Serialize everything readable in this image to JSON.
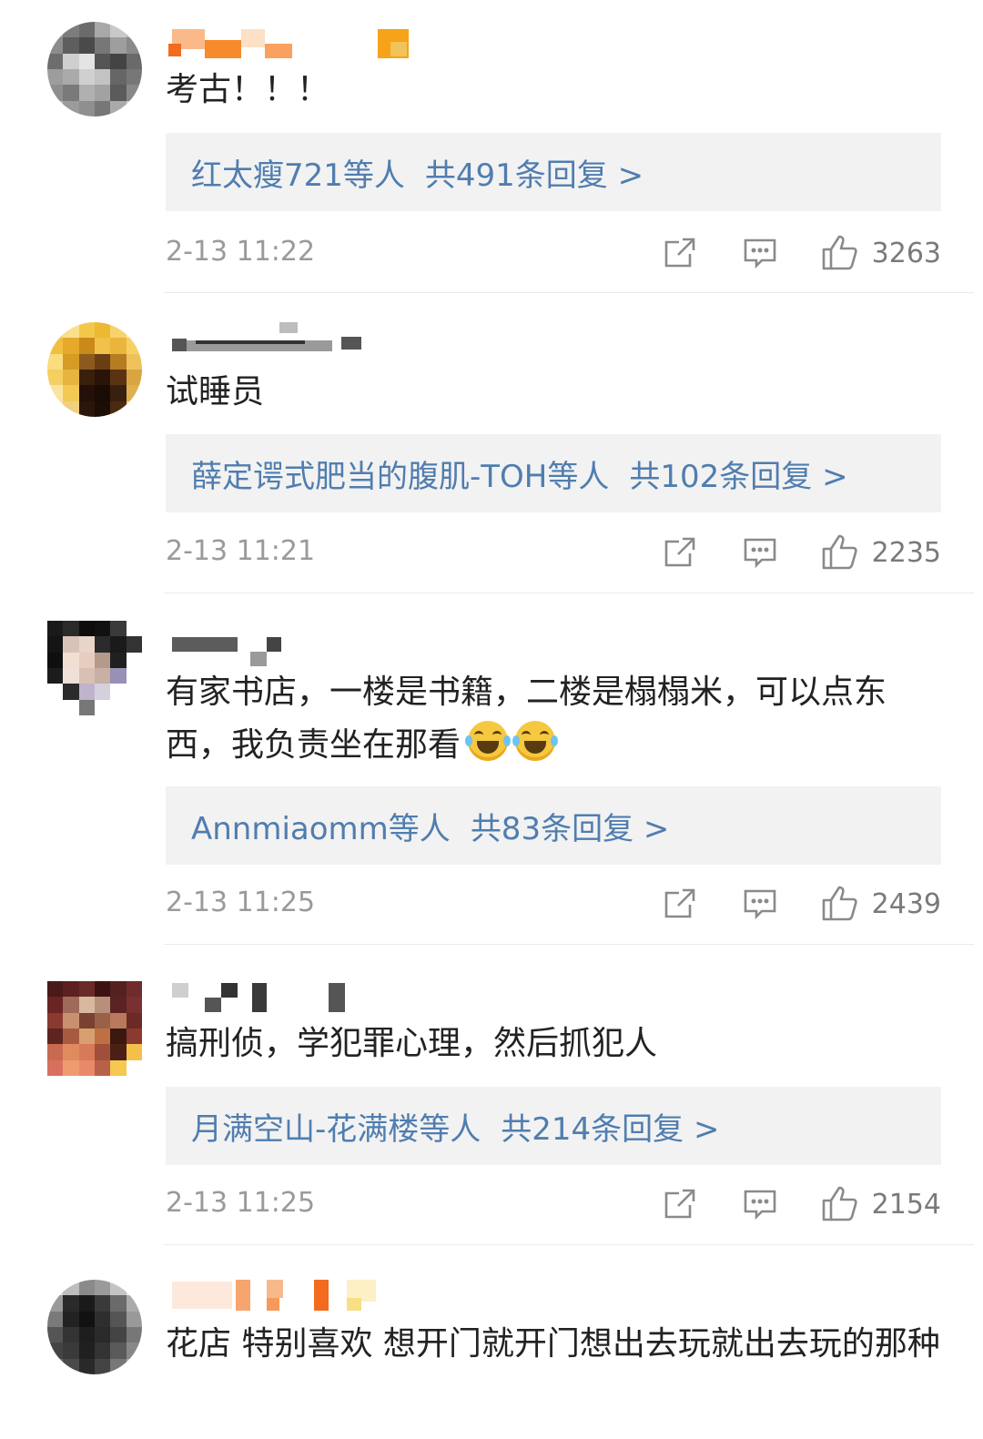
{
  "colors": {
    "reply_link": "#507daf",
    "reply_bg": "#f2f2f2",
    "text": "#222222",
    "meta": "#9a9a9a"
  },
  "icons": {
    "forward": "share-forward-icon",
    "comment": "comment-bubble-icon",
    "like": "thumbs-up-icon",
    "emoji": "laughing-crying-emoji-icon"
  },
  "comments": [
    {
      "text": "考古！！！",
      "replies": {
        "names": "红太瘦721等人",
        "total": "共491条回复 >"
      },
      "time": "2-13 11:22",
      "likes": "3263"
    },
    {
      "text": "试睡员",
      "replies": {
        "names": "薛定谔式肥当的腹肌-TOH等人",
        "total": "共102条回复 >"
      },
      "time": "2-13 11:21",
      "likes": "2235"
    },
    {
      "text": "有家书店，一楼是书籍，二楼是榻榻米，可以点东西，我负责坐在那看",
      "replies": {
        "names": "Annmiaomm等人",
        "total": "共83条回复 >"
      },
      "time": "2-13 11:25",
      "likes": "2439"
    },
    {
      "text": "搞刑侦，学犯罪心理，然后抓犯人",
      "replies": {
        "names": "月满空山-花满楼等人",
        "total": "共214条回复 >"
      },
      "time": "2-13 11:25",
      "likes": "2154"
    },
    {
      "text": "花店 特别喜欢 想开门就开门想出去玩就出去玩的那种"
    }
  ]
}
